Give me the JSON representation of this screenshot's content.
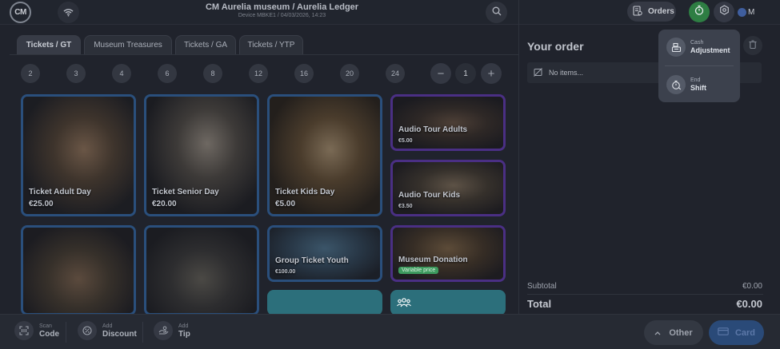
{
  "header": {
    "logo_text": "CM",
    "title": "CM Aurelia museum / Aurelia Ledger",
    "subtitle": "Device MBKE1 / 04/03/2026, 14:23",
    "orders_label": "Orders",
    "user_initial": "M"
  },
  "tabs": [
    {
      "label": "Tickets / GT",
      "active": true
    },
    {
      "label": "Museum Treasures",
      "active": false
    },
    {
      "label": "Tickets / GA",
      "active": false
    },
    {
      "label": "Tickets / YTP",
      "active": false
    }
  ],
  "quick_quantities": [
    "2",
    "3",
    "4",
    "6",
    "8",
    "12",
    "16",
    "20",
    "24"
  ],
  "stepper": {
    "minus": "−",
    "value": "1",
    "plus": "+"
  },
  "tiles": [
    {
      "name": "Ticket Adult Day",
      "price": "€25.00"
    },
    {
      "name": "Ticket Senior Day",
      "price": "€20.00"
    },
    {
      "name": "Ticket Kids Day",
      "price": "€5.00"
    },
    {
      "name": "Audio Tour Adults",
      "price": "€5.00"
    },
    {
      "name": "Audio Tour Kids",
      "price": "€3.50"
    },
    {
      "name": "Group Ticket Youth",
      "price": "€100.00"
    },
    {
      "name": "Museum Donation",
      "badge": "Variable price"
    }
  ],
  "order": {
    "title": "Your order",
    "empty_label": "No items...",
    "subtotal_label": "Subtotal",
    "subtotal_value": "€0.00",
    "total_label": "Total",
    "total_value": "€0.00"
  },
  "popup_menu": [
    {
      "small": "Cash",
      "big": "Adjustment",
      "icon": "cash-register-icon"
    },
    {
      "small": "End",
      "big": "Shift",
      "icon": "end-shift-icon"
    }
  ],
  "bottom": {
    "scan": {
      "small": "Scan",
      "big": "Code"
    },
    "discount": {
      "small": "Add",
      "big": "Discount"
    },
    "tip": {
      "small": "Add",
      "big": "Tip"
    },
    "other_label": "Other",
    "card_label": "Card"
  },
  "colors": {
    "background": "#20232c",
    "timer_green": "#2e7e43",
    "tile_border_blue": "#2a4f7c",
    "tile_border_purple": "#4a2f84",
    "tile_teal": "#2c6f7b",
    "badge_green": "#3d9a5e",
    "card_blue": "#2a4a78"
  }
}
